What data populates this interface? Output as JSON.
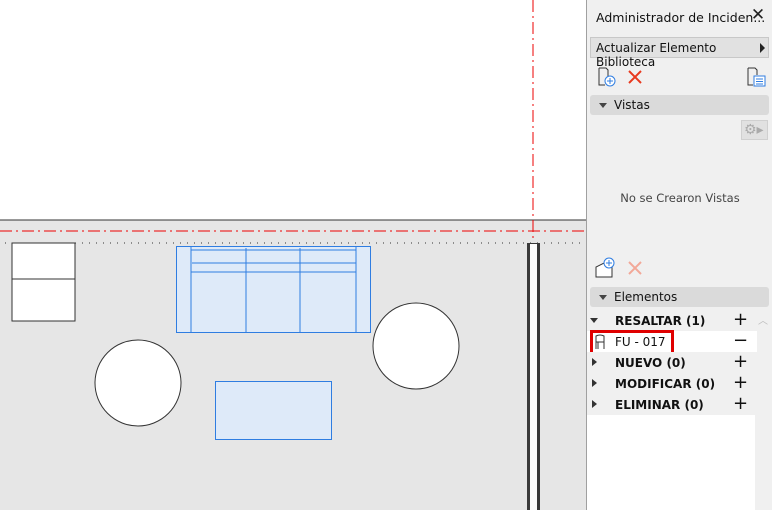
{
  "panel": {
    "title": "Administrador de Inciden...",
    "action_button": "Actualizar Elemento Biblioteca",
    "views_section": "Vistas",
    "no_views_text": "No se Crearon Vistas",
    "elements_section": "Elementos",
    "groups": [
      {
        "label": "RESALTAR (1)",
        "expanded": true,
        "control": "+"
      },
      {
        "label": "NUEVO (0)",
        "expanded": false,
        "control": "+"
      },
      {
        "label": "MODIFICAR (0)",
        "expanded": false,
        "control": "+"
      },
      {
        "label": "ELIMINAR (0)",
        "expanded": false,
        "control": "+"
      }
    ],
    "selected_item": {
      "label": "FU - 017",
      "control": "−",
      "icon": "chair-icon"
    }
  },
  "colors": {
    "accent_blue": "#2f7de1",
    "delete_red": "#e8391e",
    "highlight_box": "#e00000",
    "floor": "#e6e6e6"
  }
}
